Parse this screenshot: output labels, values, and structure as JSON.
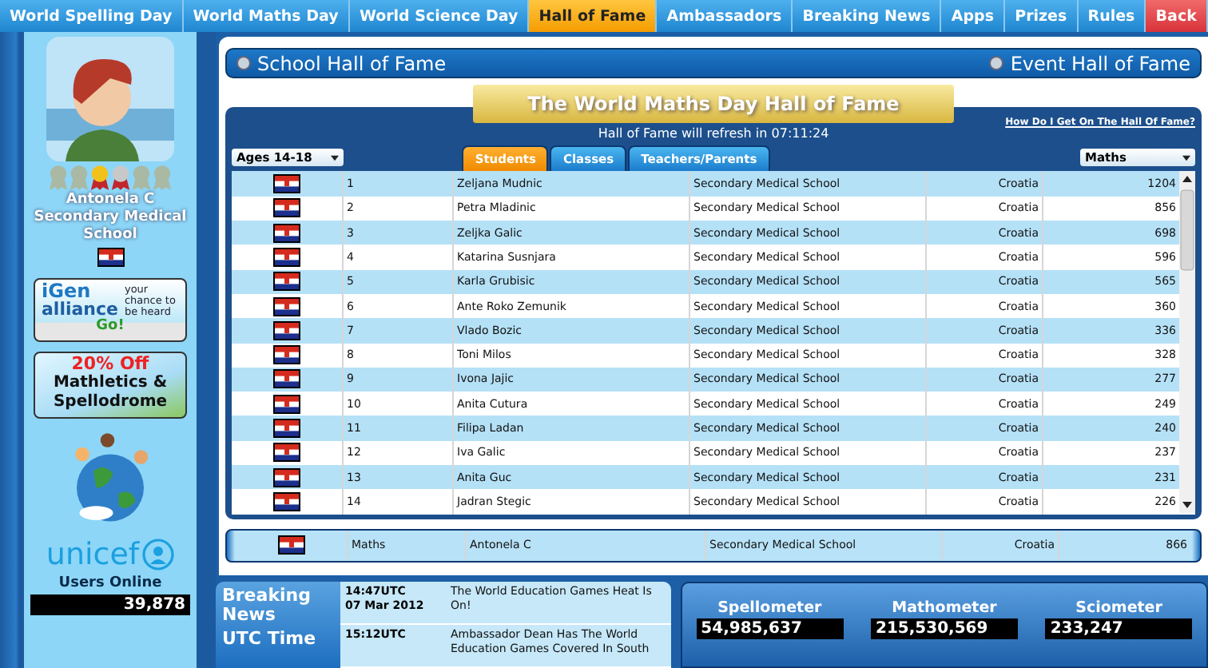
{
  "nav": [
    {
      "label": "World Spelling Day",
      "selected": false,
      "kind": "tab"
    },
    {
      "label": "World Maths Day",
      "selected": false,
      "kind": "tab"
    },
    {
      "label": "World Science Day",
      "selected": false,
      "kind": "tab"
    },
    {
      "label": "Hall of Fame",
      "selected": true,
      "kind": "tab"
    },
    {
      "label": "Ambassadors",
      "selected": false,
      "kind": "tab"
    },
    {
      "label": "Breaking News",
      "selected": false,
      "kind": "tab"
    },
    {
      "label": "Apps",
      "selected": false,
      "kind": "tab"
    },
    {
      "label": "Prizes",
      "selected": false,
      "kind": "tab"
    },
    {
      "label": "Rules",
      "selected": false,
      "kind": "tab"
    },
    {
      "label": "Back",
      "selected": false,
      "kind": "back"
    }
  ],
  "profile": {
    "medals": [
      {
        "kind": "empty"
      },
      {
        "kind": "empty"
      },
      {
        "kind": "gold"
      },
      {
        "kind": "silver"
      },
      {
        "kind": "empty"
      },
      {
        "kind": "empty"
      }
    ],
    "name": "Antonela C",
    "school": "Secondary Medical School"
  },
  "promos": {
    "igen": {
      "brand_1": "iGen",
      "brand_2": "alliance",
      "tagline": "your chance to be heard",
      "action": "Go!"
    },
    "offer": {
      "discount": "20% Off",
      "line_1": "Mathletics &",
      "line_2": "Spellodrome"
    },
    "unicef": "unicef"
  },
  "users_online": {
    "label": "Users Online",
    "count": "39,878"
  },
  "hall_switch": [
    {
      "label": "School Hall of Fame",
      "selected": false
    },
    {
      "label": "Event Hall of Fame",
      "selected": false
    }
  ],
  "banner": "The World Maths Day Hall of Fame",
  "refresh": "Hall of Fame will refresh in 07:11:24",
  "help_link": "How Do I Get On The Hall Of Fame?",
  "age_filter": "Ages 14-18",
  "subject_filter": "Maths",
  "tabs": [
    {
      "label": "Students",
      "selected": true
    },
    {
      "label": "Classes",
      "selected": false
    },
    {
      "label": "Teachers/Parents",
      "selected": false
    }
  ],
  "table": {
    "rows": [
      {
        "rank": "1",
        "name": "Zeljana Mudnic",
        "school": "Secondary Medical School",
        "country": "Croatia",
        "score": "1204"
      },
      {
        "rank": "2",
        "name": "Petra Mladinic",
        "school": "Secondary Medical School",
        "country": "Croatia",
        "score": "856"
      },
      {
        "rank": "3",
        "name": "Zeljka Galic",
        "school": "Secondary Medical School",
        "country": "Croatia",
        "score": "698"
      },
      {
        "rank": "4",
        "name": "Katarina Susnjara",
        "school": "Secondary Medical School",
        "country": "Croatia",
        "score": "596"
      },
      {
        "rank": "5",
        "name": "Karla Grubisic",
        "school": "Secondary Medical School",
        "country": "Croatia",
        "score": "565"
      },
      {
        "rank": "6",
        "name": "Ante Roko Zemunik",
        "school": "Secondary Medical School",
        "country": "Croatia",
        "score": "360"
      },
      {
        "rank": "7",
        "name": "Vlado Bozic",
        "school": "Secondary Medical School",
        "country": "Croatia",
        "score": "336"
      },
      {
        "rank": "8",
        "name": "Toni Milos",
        "school": "Secondary Medical School",
        "country": "Croatia",
        "score": "328"
      },
      {
        "rank": "9",
        "name": "Ivona Jajic",
        "school": "Secondary Medical School",
        "country": "Croatia",
        "score": "277"
      },
      {
        "rank": "10",
        "name": "Anita Cutura",
        "school": "Secondary Medical School",
        "country": "Croatia",
        "score": "249"
      },
      {
        "rank": "11",
        "name": "Filipa Ladan",
        "school": "Secondary Medical School",
        "country": "Croatia",
        "score": "240"
      },
      {
        "rank": "12",
        "name": "Iva Galic",
        "school": "Secondary Medical School",
        "country": "Croatia",
        "score": "237"
      },
      {
        "rank": "13",
        "name": "Anita Guc",
        "school": "Secondary Medical School",
        "country": "Croatia",
        "score": "231"
      },
      {
        "rank": "14",
        "name": "Jadran Stegic",
        "school": "Secondary Medical School",
        "country": "Croatia",
        "score": "226"
      }
    ]
  },
  "my_row": {
    "subject": "Maths",
    "name": "Antonela C",
    "school": "Secondary Medical School",
    "country": "Croatia",
    "score": "866"
  },
  "news": {
    "title_1": "Breaking News",
    "title_2": "UTC Time",
    "items": [
      {
        "time": "14:47UTC",
        "date": "07 Mar 2012",
        "text": "The World Education Games Heat Is On!"
      },
      {
        "time": "15:12UTC",
        "text": "Ambassador Dean Has The World Education Games Covered In South"
      }
    ]
  },
  "meters": [
    {
      "label": "Spellometer",
      "value": "54,985,637"
    },
    {
      "label": "Mathometer",
      "value": "215,530,569"
    },
    {
      "label": "Sciometer",
      "value": "233,247"
    }
  ]
}
